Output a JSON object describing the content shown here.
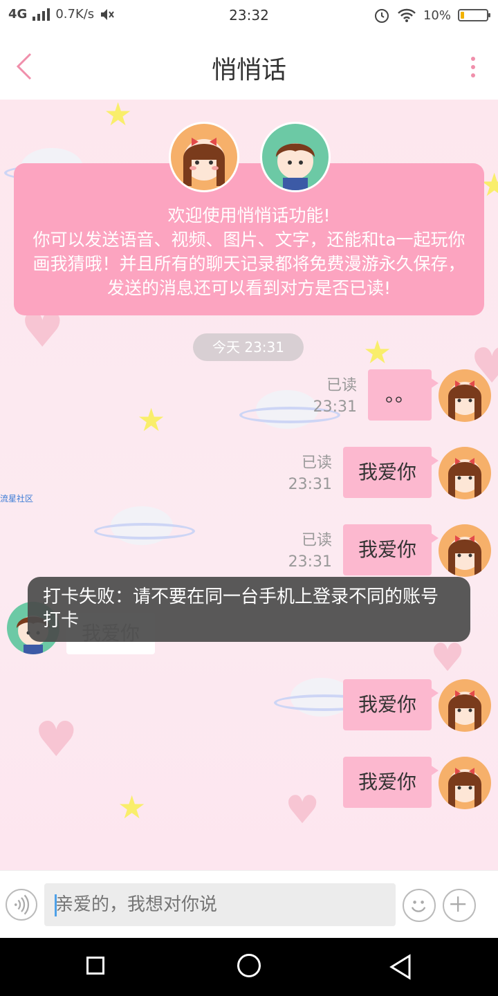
{
  "status_bar": {
    "network": "4G",
    "speed": "0.7K/s",
    "time": "23:32",
    "battery": "10%"
  },
  "header": {
    "title": "悄悄话"
  },
  "welcome": {
    "text": "欢迎使用悄悄话功能!\n你可以发送语音、视频、图片、文字，还能和ta一起玩你画我猜哦！并且所有的聊天记录都将免费漫游永久保存，发送的消息还可以看到对方是否已读!"
  },
  "timestamp": "今天 23:31",
  "messages": [
    {
      "text": "。。",
      "status": "已读",
      "time": "23:31"
    },
    {
      "text": "我爱你",
      "status": "已读",
      "time": "23:31"
    },
    {
      "text": "我爱你",
      "status": "已读",
      "time": "23:31"
    },
    {
      "text": "我爱你"
    },
    {
      "text": "我爱你"
    }
  ],
  "received_message": "我爱你",
  "watermark_link": "流星社区",
  "toast": "打卡失败：请不要在同一台手机上登录不同的账号打卡",
  "input": {
    "placeholder": "亲爱的，我想对你说"
  },
  "colors": {
    "accent_pink": "#fca4c0",
    "bubble_pink": "#fcb8cf",
    "back_arrow": "#f08fab"
  }
}
